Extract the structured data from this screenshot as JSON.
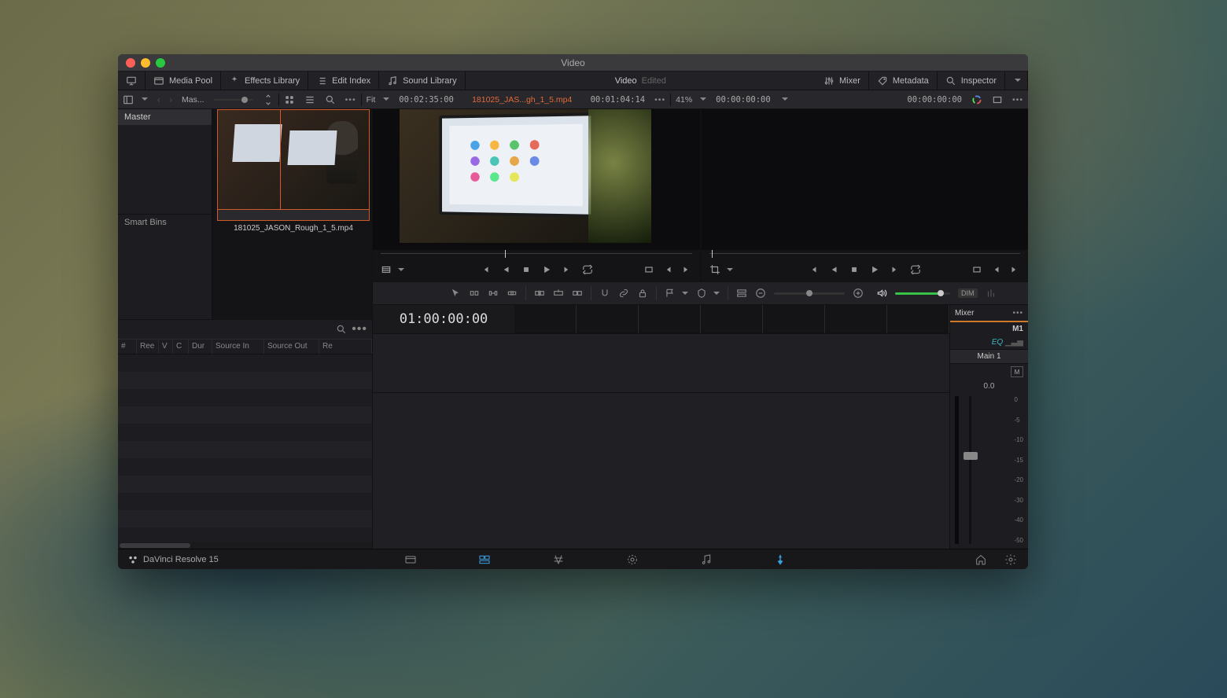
{
  "window": {
    "title": "Video"
  },
  "toolbar": {
    "media_pool": "Media Pool",
    "effects_library": "Effects Library",
    "edit_index": "Edit Index",
    "sound_library": "Sound Library",
    "center_title": "Video",
    "center_sub": "Edited",
    "mixer": "Mixer",
    "metadata": "Metadata",
    "inspector": "Inspector"
  },
  "subbar": {
    "bin_label": "Mas...",
    "fit": "Fit",
    "src_duration": "00:02:35:00",
    "clip_name": "181025_JAS...gh_1_5.mp4",
    "src_tc": "00:01:04:14",
    "zoom": "41%",
    "rec_in": "00:00:00:00",
    "rec_out": "00:00:00:00"
  },
  "bins": {
    "master": "Master",
    "smart": "Smart Bins"
  },
  "clip": {
    "filename": "181025_JASON_Rough_1_5.mp4"
  },
  "index": {
    "cols": [
      "#",
      "Ree",
      "V",
      "C",
      "Dur",
      "Source In",
      "Source Out",
      "Re"
    ]
  },
  "timeline": {
    "timecode": "01:00:00:00"
  },
  "mixer": {
    "title": "Mixer",
    "bus": "M1",
    "eq": "EQ",
    "name": "Main 1",
    "mute": "M",
    "db": "0.0",
    "scale": [
      "0",
      "-5",
      "-10",
      "-15",
      "-20",
      "-30",
      "-40",
      "-50"
    ]
  },
  "volume": {
    "dim": "DIM"
  },
  "footer": {
    "app": "DaVinci Resolve 15"
  }
}
